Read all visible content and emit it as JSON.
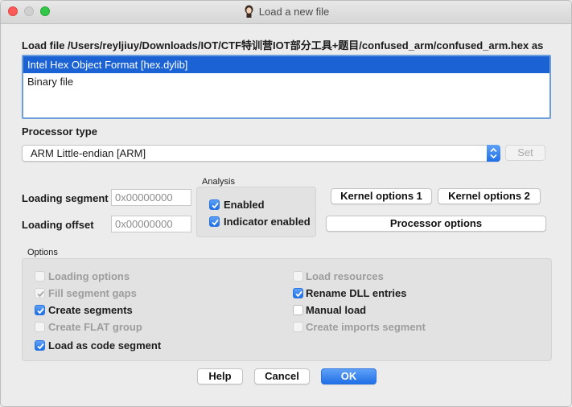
{
  "window": {
    "title": "Load a new file"
  },
  "load_file_label": "Load file /Users/reyljiuy/Downloads/IOT/CTF特训营IOT部分工具+题目/confused_arm/confused_arm.hex as",
  "formats": [
    {
      "label": "Intel Hex Object Format [hex.dylib]",
      "selected": true
    },
    {
      "label": "Binary file",
      "selected": false
    }
  ],
  "processor": {
    "label": "Processor type",
    "selected": "ARM Little-endian [ARM]",
    "set_button": "Set"
  },
  "loading": {
    "segment_label": "Loading segment",
    "segment_value": "0x00000000",
    "offset_label": "Loading offset",
    "offset_value": "0x00000000"
  },
  "analysis": {
    "title": "Analysis",
    "enabled_label": "Enabled",
    "enabled_checked": true,
    "indicator_label": "Indicator enabled",
    "indicator_checked": true
  },
  "buttons": {
    "kernel1": "Kernel options 1",
    "kernel2": "Kernel options 2",
    "processor_options": "Processor options",
    "help": "Help",
    "cancel": "Cancel",
    "ok": "OK"
  },
  "options": {
    "title": "Options",
    "left": [
      {
        "label": "Loading options",
        "checked": false,
        "enabled": false
      },
      {
        "label": "Fill segment gaps",
        "checked": true,
        "enabled": false
      },
      {
        "label": "Create segments",
        "checked": true,
        "enabled": true
      },
      {
        "label": "Create FLAT group",
        "checked": false,
        "enabled": false
      },
      {
        "label": "Load as code segment",
        "checked": true,
        "enabled": true
      }
    ],
    "right": [
      {
        "label": "Load resources",
        "checked": false,
        "enabled": false
      },
      {
        "label": "Rename DLL entries",
        "checked": true,
        "enabled": true
      },
      {
        "label": "Manual load",
        "checked": false,
        "enabled": true
      },
      {
        "label": "Create imports segment",
        "checked": false,
        "enabled": false
      }
    ]
  },
  "colors": {
    "accent": "#1f6fe6",
    "selection": "#1b63d5"
  }
}
